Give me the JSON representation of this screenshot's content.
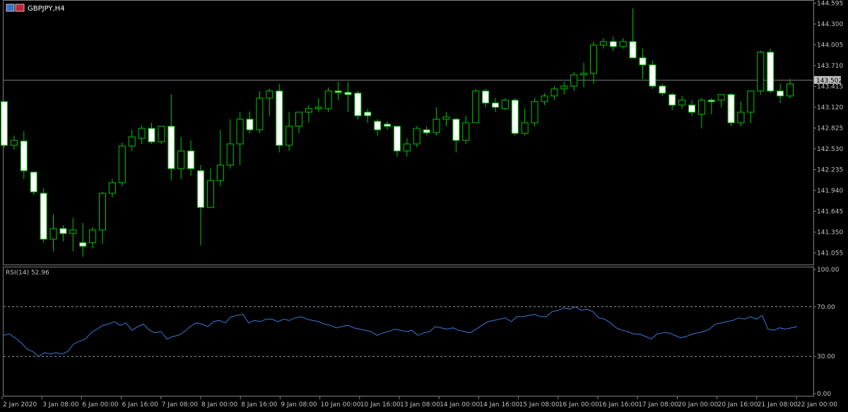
{
  "window": {
    "title": "GBPJPY,H4",
    "colors": {
      "background": "#000000",
      "bull_outline": "#00c800",
      "bear_body": "#ffffff",
      "rsi_line": "#3c78d8",
      "panel_border": "#7f7f7f",
      "current_price_line": "#808080"
    }
  },
  "indicator": {
    "label": "RSI(14) 52.96"
  },
  "chart_data": [
    {
      "type": "candlestick",
      "title": "GBPJPY,H4",
      "timeframe": "H4",
      "ylim": [
        140.9,
        144.62
      ],
      "yticks": [
        "144.595",
        "144.300",
        "144.005",
        "143.710",
        "143.415",
        "143.120",
        "142.825",
        "142.530",
        "142.235",
        "141.940",
        "141.645",
        "141.350",
        "141.055"
      ],
      "current_price": 143.502,
      "current_price_label": "143.502",
      "xticks": [
        "2 Jan 2020",
        "3 Jan 08:00",
        "6 Jan 00:00",
        "6 Jan 16:00",
        "7 Jan 08:00",
        "8 Jan 00:00",
        "8 Jan 16:00",
        "9 Jan 08:00",
        "10 Jan 00:00",
        "10 Jan 16:00",
        "13 Jan 08:00",
        "14 Jan 00:00",
        "14 Jan 16:00",
        "15 Jan 08:00",
        "16 Jan 00:00",
        "16 Jan 16:00",
        "17 Jan 08:00",
        "20 Jan 00:00",
        "20 Jan 16:00",
        "21 Jan 08:00",
        "22 Jan 00:00"
      ],
      "grid": false,
      "candles": [
        {
          "o": 143.2,
          "h": 143.2,
          "l": 142.55,
          "c": 142.58
        },
        {
          "o": 142.58,
          "h": 142.72,
          "l": 142.52,
          "c": 142.65
        },
        {
          "o": 142.64,
          "h": 142.78,
          "l": 142.1,
          "c": 142.22
        },
        {
          "o": 142.2,
          "h": 142.2,
          "l": 141.88,
          "c": 141.92
        },
        {
          "o": 141.9,
          "h": 141.97,
          "l": 141.2,
          "c": 141.25
        },
        {
          "o": 141.25,
          "h": 141.6,
          "l": 141.08,
          "c": 141.4
        },
        {
          "o": 141.4,
          "h": 141.45,
          "l": 141.22,
          "c": 141.33
        },
        {
          "o": 141.33,
          "h": 141.55,
          "l": 141.08,
          "c": 141.38
        },
        {
          "o": 141.2,
          "h": 141.48,
          "l": 141.0,
          "c": 141.15
        },
        {
          "o": 141.2,
          "h": 141.42,
          "l": 141.12,
          "c": 141.38
        },
        {
          "o": 141.38,
          "h": 141.92,
          "l": 141.18,
          "c": 141.9
        },
        {
          "o": 141.9,
          "h": 142.1,
          "l": 141.84,
          "c": 142.05
        },
        {
          "o": 142.05,
          "h": 142.62,
          "l": 142.0,
          "c": 142.57
        },
        {
          "o": 142.57,
          "h": 142.8,
          "l": 142.5,
          "c": 142.7
        },
        {
          "o": 142.68,
          "h": 142.86,
          "l": 142.6,
          "c": 142.82
        },
        {
          "o": 142.82,
          "h": 142.9,
          "l": 142.6,
          "c": 142.63
        },
        {
          "o": 142.63,
          "h": 142.85,
          "l": 142.6,
          "c": 142.85
        },
        {
          "o": 142.85,
          "h": 143.3,
          "l": 142.08,
          "c": 142.25
        },
        {
          "o": 142.25,
          "h": 142.7,
          "l": 142.1,
          "c": 142.5
        },
        {
          "o": 142.5,
          "h": 142.65,
          "l": 142.15,
          "c": 142.25
        },
        {
          "o": 142.22,
          "h": 142.3,
          "l": 141.16,
          "c": 141.7
        },
        {
          "o": 141.7,
          "h": 142.25,
          "l": 141.7,
          "c": 142.08
        },
        {
          "o": 142.08,
          "h": 142.8,
          "l": 142.0,
          "c": 142.3
        },
        {
          "o": 142.3,
          "h": 142.95,
          "l": 142.25,
          "c": 142.6
        },
        {
          "o": 142.6,
          "h": 143.05,
          "l": 142.3,
          "c": 142.95
        },
        {
          "o": 142.95,
          "h": 143.06,
          "l": 142.75,
          "c": 142.8
        },
        {
          "o": 142.8,
          "h": 143.35,
          "l": 142.75,
          "c": 143.25
        },
        {
          "o": 143.25,
          "h": 143.38,
          "l": 143.0,
          "c": 143.35
        },
        {
          "o": 143.35,
          "h": 143.45,
          "l": 142.48,
          "c": 142.58
        },
        {
          "o": 142.58,
          "h": 143.05,
          "l": 142.5,
          "c": 142.85
        },
        {
          "o": 142.85,
          "h": 143.05,
          "l": 142.75,
          "c": 143.05
        },
        {
          "o": 143.05,
          "h": 143.15,
          "l": 142.9,
          "c": 143.1
        },
        {
          "o": 143.1,
          "h": 143.25,
          "l": 143.05,
          "c": 143.12
        },
        {
          "o": 143.1,
          "h": 143.4,
          "l": 143.05,
          "c": 143.35
        },
        {
          "o": 143.35,
          "h": 143.48,
          "l": 143.22,
          "c": 143.33
        },
        {
          "o": 143.33,
          "h": 143.48,
          "l": 143.05,
          "c": 143.3
        },
        {
          "o": 143.32,
          "h": 143.35,
          "l": 142.95,
          "c": 143.0
        },
        {
          "o": 143.05,
          "h": 143.1,
          "l": 142.9,
          "c": 143.0
        },
        {
          "o": 142.92,
          "h": 142.95,
          "l": 142.72,
          "c": 142.8
        },
        {
          "o": 142.88,
          "h": 142.92,
          "l": 142.8,
          "c": 142.85
        },
        {
          "o": 142.85,
          "h": 142.85,
          "l": 142.42,
          "c": 142.5
        },
        {
          "o": 142.5,
          "h": 142.68,
          "l": 142.42,
          "c": 142.6
        },
        {
          "o": 142.6,
          "h": 142.85,
          "l": 142.55,
          "c": 142.82
        },
        {
          "o": 142.8,
          "h": 142.85,
          "l": 142.72,
          "c": 142.76
        },
        {
          "o": 142.76,
          "h": 143.12,
          "l": 142.72,
          "c": 142.95
        },
        {
          "o": 142.95,
          "h": 143.05,
          "l": 142.85,
          "c": 142.98
        },
        {
          "o": 142.95,
          "h": 142.97,
          "l": 142.48,
          "c": 142.65
        },
        {
          "o": 142.65,
          "h": 143.0,
          "l": 142.6,
          "c": 142.9
        },
        {
          "o": 142.9,
          "h": 143.38,
          "l": 142.9,
          "c": 143.35
        },
        {
          "o": 143.35,
          "h": 143.38,
          "l": 143.12,
          "c": 143.18
        },
        {
          "o": 143.18,
          "h": 143.25,
          "l": 143.05,
          "c": 143.12
        },
        {
          "o": 143.1,
          "h": 143.25,
          "l": 143.08,
          "c": 143.22
        },
        {
          "o": 143.22,
          "h": 143.25,
          "l": 142.72,
          "c": 142.75
        },
        {
          "o": 142.75,
          "h": 143.1,
          "l": 142.72,
          "c": 142.9
        },
        {
          "o": 142.9,
          "h": 143.25,
          "l": 142.85,
          "c": 143.2
        },
        {
          "o": 143.2,
          "h": 143.32,
          "l": 143.15,
          "c": 143.28
        },
        {
          "o": 143.28,
          "h": 143.42,
          "l": 143.22,
          "c": 143.38
        },
        {
          "o": 143.38,
          "h": 143.48,
          "l": 143.3,
          "c": 143.42
        },
        {
          "o": 143.42,
          "h": 143.62,
          "l": 143.35,
          "c": 143.58
        },
        {
          "o": 143.58,
          "h": 143.75,
          "l": 143.4,
          "c": 143.6
        },
        {
          "o": 143.6,
          "h": 144.05,
          "l": 143.45,
          "c": 144.0
        },
        {
          "o": 144.0,
          "h": 144.1,
          "l": 143.95,
          "c": 144.05
        },
        {
          "o": 144.05,
          "h": 144.12,
          "l": 143.92,
          "c": 143.98
        },
        {
          "o": 143.98,
          "h": 144.1,
          "l": 143.95,
          "c": 144.05
        },
        {
          "o": 144.05,
          "h": 144.52,
          "l": 143.85,
          "c": 143.82
        },
        {
          "o": 143.82,
          "h": 143.95,
          "l": 143.52,
          "c": 143.72
        },
        {
          "o": 143.72,
          "h": 143.78,
          "l": 143.38,
          "c": 143.42
        },
        {
          "o": 143.42,
          "h": 143.45,
          "l": 143.28,
          "c": 143.32
        },
        {
          "o": 143.3,
          "h": 143.32,
          "l": 143.08,
          "c": 143.15
        },
        {
          "o": 143.15,
          "h": 143.28,
          "l": 143.1,
          "c": 143.22
        },
        {
          "o": 143.15,
          "h": 143.22,
          "l": 143.0,
          "c": 143.05
        },
        {
          "o": 143.02,
          "h": 143.25,
          "l": 142.82,
          "c": 143.22
        },
        {
          "o": 143.22,
          "h": 143.25,
          "l": 143.02,
          "c": 143.2
        },
        {
          "o": 143.22,
          "h": 143.28,
          "l": 143.12,
          "c": 143.3
        },
        {
          "o": 143.3,
          "h": 143.32,
          "l": 142.85,
          "c": 142.9
        },
        {
          "o": 142.9,
          "h": 143.2,
          "l": 142.85,
          "c": 143.05
        },
        {
          "o": 143.05,
          "h": 143.32,
          "l": 142.9,
          "c": 143.35
        },
        {
          "o": 143.35,
          "h": 143.92,
          "l": 143.3,
          "c": 143.9
        },
        {
          "o": 143.9,
          "h": 143.95,
          "l": 143.32,
          "c": 143.35
        },
        {
          "o": 143.35,
          "h": 143.45,
          "l": 143.18,
          "c": 143.28
        },
        {
          "o": 143.28,
          "h": 143.52,
          "l": 143.25,
          "c": 143.45
        }
      ]
    },
    {
      "type": "line",
      "title": "RSI(14) 52.96",
      "ylim": [
        0,
        100
      ],
      "yticks": [
        "100.00",
        "70.00",
        "30.00",
        "0.00"
      ],
      "levels": [
        70,
        30
      ],
      "series": [
        {
          "values": [
            47,
            48,
            45,
            41,
            36,
            34,
            30,
            33,
            32,
            33,
            32,
            34,
            40,
            42,
            44,
            49,
            52,
            55,
            56,
            58,
            55,
            57,
            51,
            54,
            56,
            51,
            49,
            50,
            44,
            46,
            47,
            50,
            54,
            57,
            56,
            54,
            58,
            59,
            57,
            62,
            63,
            64,
            57,
            59,
            58,
            60,
            60,
            58,
            60,
            59,
            61,
            62,
            60,
            59,
            58,
            56,
            55,
            53,
            54,
            55,
            53,
            52,
            51,
            50,
            47,
            49,
            50,
            52,
            51,
            50,
            51,
            47,
            49,
            50,
            54,
            53,
            52,
            53,
            51,
            50,
            49,
            52,
            55,
            58,
            59,
            60,
            61,
            58,
            62,
            62,
            63,
            64,
            62,
            62,
            66,
            67,
            69,
            68,
            70,
            67,
            68,
            66,
            61,
            60,
            57,
            53,
            51,
            50,
            48,
            48,
            46,
            44,
            48,
            49,
            49,
            47,
            45,
            46,
            48,
            49,
            50,
            52,
            56,
            57,
            58,
            59,
            61,
            60,
            62,
            60,
            63,
            52,
            51,
            53,
            52,
            53,
            54
          ]
        }
      ]
    }
  ]
}
